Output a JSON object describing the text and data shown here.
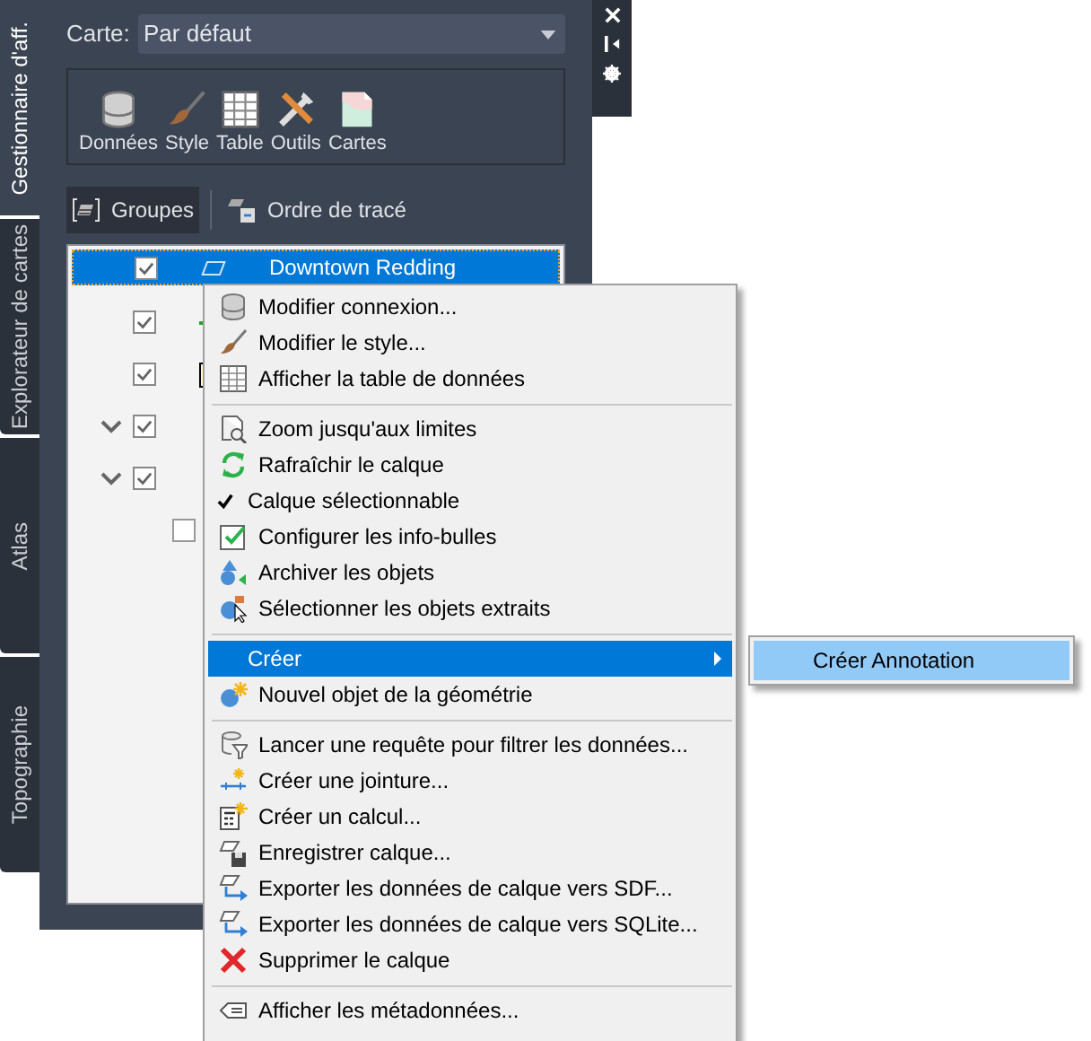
{
  "panel_tabs": [
    {
      "label": "Gestionnaire d'aff.",
      "selected": true
    },
    {
      "label": "Explorateur de cartes",
      "selected": false
    },
    {
      "label": "Atlas",
      "selected": false
    },
    {
      "label": "Topographie",
      "selected": false
    }
  ],
  "map_selector": {
    "label": "Carte:",
    "value": "Par défaut"
  },
  "toolbar": [
    {
      "label": "Données"
    },
    {
      "label": "Style"
    },
    {
      "label": "Table"
    },
    {
      "label": "Outils"
    },
    {
      "label": "Cartes"
    }
  ],
  "view_tabs": [
    {
      "label": "Groupes",
      "selected": true
    },
    {
      "label": "Ordre de tracé",
      "selected": false
    }
  ],
  "layers": [
    {
      "kind": "layer",
      "name": "Downtown Redding",
      "checked": true,
      "selected": true
    },
    {
      "kind": "line",
      "checked": true,
      "selected": false
    },
    {
      "kind": "polygon",
      "checked": true,
      "selected": false
    },
    {
      "kind": "group",
      "checked": true,
      "expanded": true,
      "selected": false
    },
    {
      "kind": "group",
      "checked": true,
      "expanded": true,
      "selected": false,
      "children": [
        {
          "checked": false,
          "selected": false
        }
      ]
    }
  ],
  "context_menu": [
    {
      "kind": "item",
      "label": "Modifier connexion...",
      "selected": false
    },
    {
      "kind": "item",
      "label": "Modifier le style...",
      "selected": false
    },
    {
      "kind": "item",
      "label": "Afficher la table de données",
      "selected": false
    },
    {
      "kind": "separator"
    },
    {
      "kind": "item",
      "label": "Zoom jusqu'aux limites",
      "selected": false
    },
    {
      "kind": "item",
      "label": "Rafraîchir le calque",
      "selected": false
    },
    {
      "kind": "check",
      "label": "Calque sélectionnable",
      "checked": true,
      "selected": false
    },
    {
      "kind": "item",
      "label": "Configurer les info-bulles",
      "selected": false
    },
    {
      "kind": "item",
      "label": "Archiver les objets",
      "selected": false
    },
    {
      "kind": "item",
      "label": "Sélectionner les objets extraits",
      "selected": false
    },
    {
      "kind": "separator"
    },
    {
      "kind": "submenu",
      "label": "Créer",
      "selected": true
    },
    {
      "kind": "item",
      "label": "Nouvel objet de la géométrie",
      "selected": false
    },
    {
      "kind": "separator"
    },
    {
      "kind": "item",
      "label": "Lancer une requête pour filtrer les données...",
      "selected": false
    },
    {
      "kind": "item",
      "label": "Créer une jointure...",
      "selected": false
    },
    {
      "kind": "item",
      "label": "Créer un calcul...",
      "selected": false
    },
    {
      "kind": "item",
      "label": "Enregistrer calque...",
      "selected": false
    },
    {
      "kind": "item",
      "label": "Exporter les données de calque vers SDF...",
      "selected": false
    },
    {
      "kind": "item",
      "label": "Exporter les données de calque vers SQLite...",
      "selected": false
    },
    {
      "kind": "item",
      "label": "Supprimer le calque",
      "selected": false
    },
    {
      "kind": "separator"
    },
    {
      "kind": "item",
      "label": "Afficher les métadonnées...",
      "selected": false
    }
  ],
  "submenu": [
    {
      "label": "Créer Annotation",
      "selected": true
    }
  ]
}
